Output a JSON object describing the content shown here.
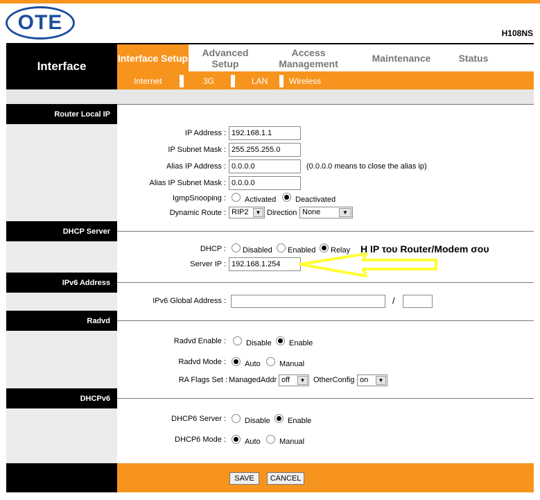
{
  "header": {
    "logo_text": "OTE",
    "model": "H108NS",
    "section_title": "Interface"
  },
  "nav": {
    "tabs": [
      "Interface Setup",
      "Advanced Setup",
      "Access Management",
      "Maintenance",
      "Status"
    ],
    "subtabs": [
      "Internet",
      "3G",
      "LAN",
      "Wireless"
    ]
  },
  "router_local_ip": {
    "title": "Router Local IP",
    "ip_address_label": "IP Address :",
    "ip_address": "192.168.1.1",
    "subnet_mask_label": "IP Subnet Mask :",
    "subnet_mask": "255.255.255.0",
    "alias_ip_label": "Alias IP Address :",
    "alias_ip": "0.0.0.0",
    "alias_note": "(0.0.0.0 means to close the alias ip)",
    "alias_mask_label": "Alias IP Subnet Mask :",
    "alias_mask": "0.0.0.0",
    "igmp_label": "IgmpSnooping :",
    "igmp_activated": "Activated",
    "igmp_deactivated": "Deactivated",
    "dynamic_route_label": "Dynamic Route :",
    "dynamic_route_value": "RIP2",
    "direction_label": "Direction",
    "direction_value": "None"
  },
  "dhcp_server": {
    "title": "DHCP Server",
    "dhcp_label": "DHCP :",
    "opt_disabled": "Disabled",
    "opt_enabled": "Enabled",
    "opt_relay": "Relay",
    "server_ip_label": "Server IP :",
    "server_ip": "192.168.1.254",
    "annotation": "H IP του Router/Modem σου"
  },
  "ipv6": {
    "title": "IPv6 Address",
    "global_label": "IPv6 Global Address :",
    "slash": "/"
  },
  "radvd": {
    "title": "Radvd",
    "enable_label": "Radvd Enable :",
    "opt_disable": "Disable",
    "opt_enable": "Enable",
    "mode_label": "Radvd Mode :",
    "opt_auto": "Auto",
    "opt_manual": "Manual",
    "flags_label": "RA Flags Set :",
    "managed_label": "ManagedAddr",
    "managed_value": "off",
    "other_label": "OtherConfig",
    "other_value": "on"
  },
  "dhcpv6": {
    "title": "DHCPv6",
    "server_label": "DHCP6 Server :",
    "opt_disable": "Disable",
    "opt_enable": "Enable",
    "mode_label": "DHCP6 Mode :",
    "opt_auto": "Auto",
    "opt_manual": "Manual"
  },
  "buttons": {
    "save": "SAVE",
    "cancel": "CANCEL"
  },
  "colors": {
    "accent": "#f7941d",
    "brand": "#1c4f9c",
    "annotation_arrow": "#ffff33"
  }
}
